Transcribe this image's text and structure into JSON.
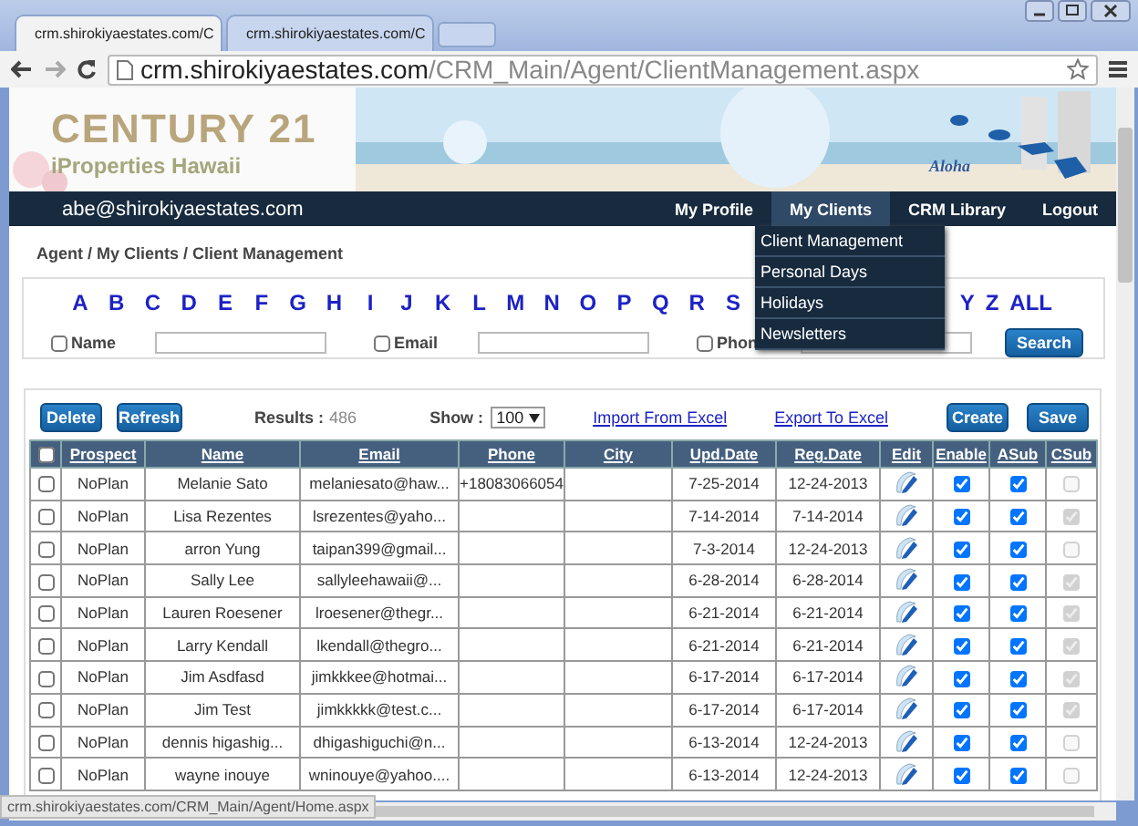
{
  "browser": {
    "tabs": [
      {
        "title": "crm.shirokiyaestates.com/C",
        "selected": true
      },
      {
        "title": "crm.shirokiyaestates.com/C",
        "selected": false
      }
    ],
    "url_host": "crm.shirokiyaestates.com",
    "url_path": "/CRM_Main/Agent/ClientManagement.aspx",
    "status_url": "crm.shirokiyaestates.com/CRM_Main/Agent/Home.aspx"
  },
  "banner": {
    "brand": "CENTURY 21",
    "subtitle": "iProperties Hawaii",
    "tagline": "Aloha"
  },
  "navbar": {
    "user": "abe@shirokiyaestates.com",
    "items": [
      {
        "label": "My Profile",
        "selected": false
      },
      {
        "label": "My Clients",
        "selected": true
      },
      {
        "label": "CRM Library",
        "selected": false
      },
      {
        "label": "Logout",
        "selected": false
      }
    ]
  },
  "dropdown": [
    "Client Management",
    "Personal Days",
    "Holidays",
    "Newsletters"
  ],
  "breadcrumb": "Agent / My Clients / Client Management",
  "letters_left": [
    "A",
    "B",
    "C",
    "D",
    "E",
    "F",
    "G",
    "H",
    "I",
    "J",
    "K",
    "L",
    "M",
    "N",
    "O",
    "P",
    "Q",
    "R",
    "S"
  ],
  "letters_right": [
    "Y",
    "Z",
    "ALL"
  ],
  "filters": [
    {
      "label": "Name",
      "checked": false
    },
    {
      "label": "Email",
      "checked": false
    },
    {
      "label": "Phon",
      "checked": false
    }
  ],
  "search_button": "Search",
  "toolbar": {
    "delete": "Delete",
    "refresh": "Refresh",
    "results_label": "Results :",
    "results": "486",
    "show_label": "Show :",
    "show_value": "100",
    "import": "Import From Excel",
    "export": "Export To Excel",
    "create": "Create",
    "save": "Save"
  },
  "table": {
    "select_all": false,
    "columns": [
      "Prospect",
      "Name",
      "Email",
      "Phone",
      "City",
      "Upd.Date",
      "Reg.Date",
      "Edit",
      "Enable",
      "ASub",
      "CSub"
    ],
    "rows": [
      {
        "selected": false,
        "prospect": "NoPlan",
        "name": "Melanie Sato",
        "email": "melaniesato@haw...",
        "phone": "+18083066054",
        "upd": "7-25-2014",
        "reg": "12-24-2013",
        "enable": true,
        "asub": true,
        "csub": false
      },
      {
        "selected": false,
        "prospect": "NoPlan",
        "name": "Lisa Rezentes",
        "email": "lsrezentes@yaho...",
        "upd": "7-14-2014",
        "reg": "7-14-2014",
        "enable": true,
        "asub": true,
        "csub": true
      },
      {
        "selected": false,
        "prospect": "NoPlan",
        "name": "arron Yung",
        "email": "taipan399@gmail...",
        "upd": "7-3-2014",
        "reg": "12-24-2013",
        "enable": true,
        "asub": true,
        "csub": false
      },
      {
        "selected": false,
        "prospect": "NoPlan",
        "name": "Sally Lee",
        "email": "sallyleehawaii@...",
        "upd": "6-28-2014",
        "reg": "6-28-2014",
        "enable": true,
        "asub": true,
        "csub": true
      },
      {
        "selected": false,
        "prospect": "NoPlan",
        "name": "Lauren Roesener",
        "email": "lroesener@thegr...",
        "upd": "6-21-2014",
        "reg": "6-21-2014",
        "enable": true,
        "asub": true,
        "csub": true
      },
      {
        "selected": false,
        "prospect": "NoPlan",
        "name": "Larry Kendall",
        "email": "lkendall@thegro...",
        "upd": "6-21-2014",
        "reg": "6-21-2014",
        "enable": true,
        "asub": true,
        "csub": true
      },
      {
        "selected": false,
        "prospect": "NoPlan",
        "name": "Jim Asdfasd",
        "email": "jimkkkee@hotmai...",
        "upd": "6-17-2014",
        "reg": "6-17-2014",
        "enable": true,
        "asub": true,
        "csub": true
      },
      {
        "selected": false,
        "prospect": "NoPlan",
        "name": "Jim Test",
        "email": "jimkkkkk@test.c...",
        "upd": "6-17-2014",
        "reg": "6-17-2014",
        "enable": true,
        "asub": true,
        "csub": true
      },
      {
        "selected": false,
        "prospect": "NoPlan",
        "name": "dennis higashig...",
        "email": "dhigashiguchi@n...",
        "upd": "6-13-2014",
        "reg": "12-24-2013",
        "enable": true,
        "asub": true,
        "csub": false
      },
      {
        "selected": false,
        "prospect": "NoPlan",
        "name": "wayne inouye",
        "email": "wninouye@yahoo....",
        "upd": "6-13-2014",
        "reg": "12-24-2013",
        "enable": true,
        "asub": true,
        "csub": false
      }
    ]
  }
}
